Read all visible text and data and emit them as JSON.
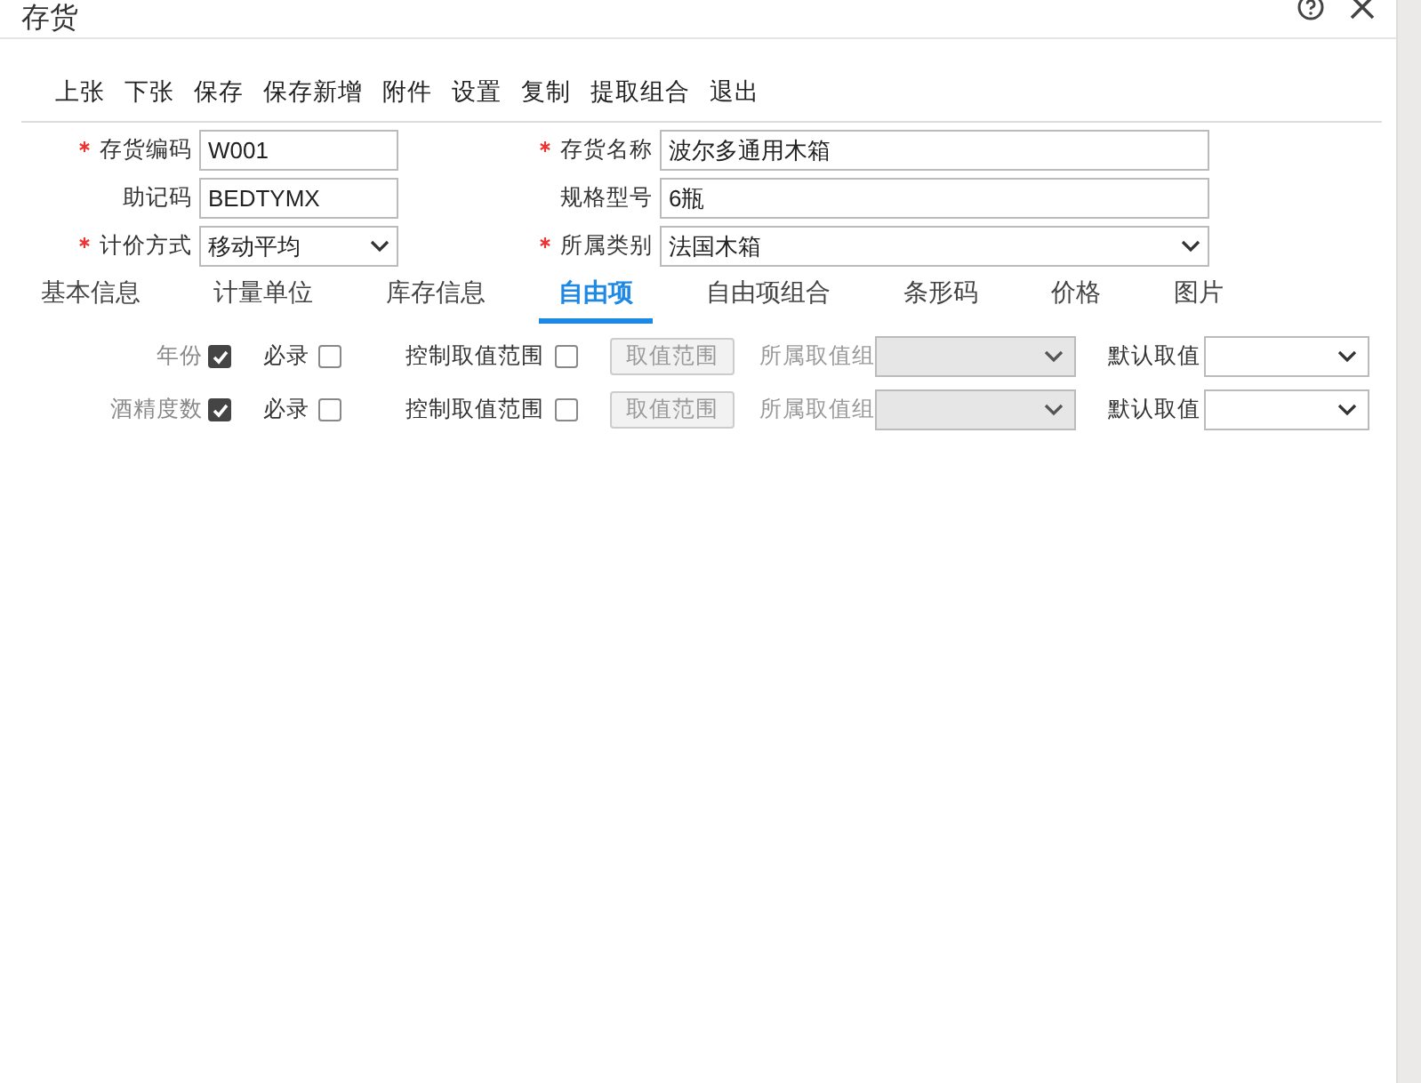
{
  "window": {
    "title": "存货"
  },
  "toolbar": [
    "上张",
    "下张",
    "保存",
    "保存新增",
    "附件",
    "设置",
    "复制",
    "提取组合",
    "退出"
  ],
  "fields": [
    {
      "label": "存货编码",
      "required": true,
      "kind": "text",
      "value": "W001"
    },
    {
      "label": "存货名称",
      "required": true,
      "kind": "text",
      "value": "波尔多通用木箱"
    },
    {
      "label": "助记码",
      "required": false,
      "kind": "text",
      "value": "BEDTYMX"
    },
    {
      "label": "规格型号",
      "required": false,
      "kind": "text",
      "value": "6瓶"
    },
    {
      "label": "计价方式",
      "required": true,
      "kind": "select",
      "value": "移动平均"
    },
    {
      "label": "所属类别",
      "required": true,
      "kind": "select",
      "value": "法国木箱"
    }
  ],
  "tabs": [
    {
      "label": "基本信息",
      "selected": false
    },
    {
      "label": "计量单位",
      "selected": false
    },
    {
      "label": "库存信息",
      "selected": false
    },
    {
      "label": "自由项",
      "selected": true
    },
    {
      "label": "自由项组合",
      "selected": false
    },
    {
      "label": "条形码",
      "selected": false
    },
    {
      "label": "价格",
      "selected": false
    },
    {
      "label": "图片",
      "selected": false
    }
  ],
  "free_items": [
    {
      "name": "年份",
      "checked": true,
      "required_label": "必录",
      "required": false,
      "range_label": "控制取值范围",
      "range_controlled": false,
      "range_button": "取值范围",
      "group_label": "所属取值组",
      "default_label": "默认取值"
    },
    {
      "name": "酒精度数",
      "checked": true,
      "required_label": "必录",
      "required": false,
      "range_label": "控制取值范围",
      "range_controlled": false,
      "range_button": "取值范围",
      "group_label": "所属取值组",
      "default_label": "默认取值"
    }
  ]
}
